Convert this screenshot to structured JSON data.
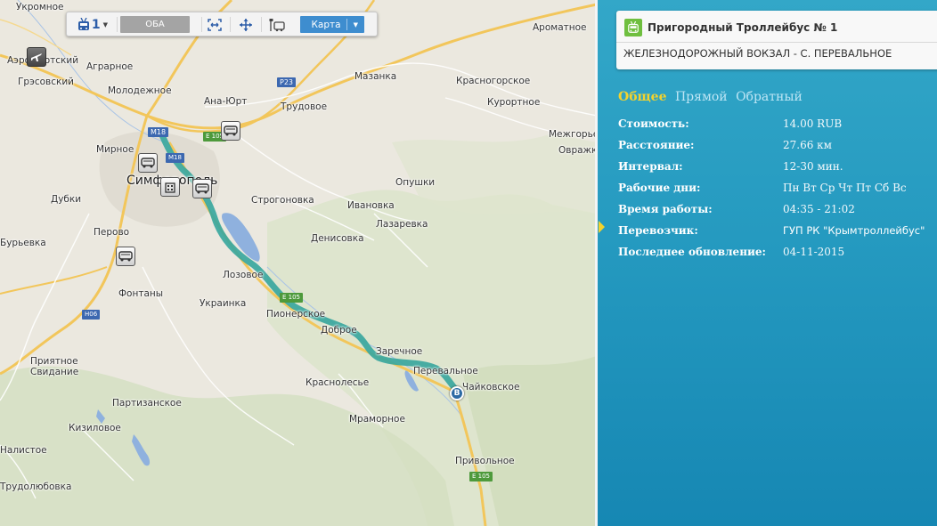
{
  "toolbar": {
    "route_icon": "trolleybus-icon",
    "route_number": "1",
    "oba_label": "ОБА",
    "fit_icon": "fit-bounds-icon",
    "pan_icon": "move-icon",
    "stops_icon": "bus-stop-icon",
    "map_type_label": "Карта"
  },
  "map": {
    "places": [
      {
        "name": "Укромное"
      },
      {
        "name": "Аэрофлотский"
      },
      {
        "name": "Аграрное"
      },
      {
        "name": "Грэсовский"
      },
      {
        "name": "Молодежное"
      },
      {
        "name": "Ана-Юрт"
      },
      {
        "name": "Мазанка"
      },
      {
        "name": "Красногорское"
      },
      {
        "name": "Ароматное"
      },
      {
        "name": "Трудовое"
      },
      {
        "name": "Курортное"
      },
      {
        "name": "Мирное"
      },
      {
        "name": "Симферополь"
      },
      {
        "name": "Межгорье"
      },
      {
        "name": "Овражки"
      },
      {
        "name": "Опушки"
      },
      {
        "name": "Строгоновка"
      },
      {
        "name": "Ивановка"
      },
      {
        "name": "Дубки"
      },
      {
        "name": "Лазаревка"
      },
      {
        "name": "Перово"
      },
      {
        "name": "Денисовка"
      },
      {
        "name": "Бурьевка"
      },
      {
        "name": "Лозовое"
      },
      {
        "name": "Фонтаны"
      },
      {
        "name": "Украинка"
      },
      {
        "name": "Пионерское"
      },
      {
        "name": "Доброе"
      },
      {
        "name": "Заречное"
      },
      {
        "name": "Приятное Свидание"
      },
      {
        "name": "Перевальное"
      },
      {
        "name": "Чайковское"
      },
      {
        "name": "Краснолесье"
      },
      {
        "name": "Партизанское"
      },
      {
        "name": "Мраморное"
      },
      {
        "name": "Кизиловое"
      },
      {
        "name": "Налистое"
      },
      {
        "name": "Привольное"
      },
      {
        "name": "Трудолюбовка"
      }
    ],
    "road_shields": [
      "M18",
      "P23",
      "E 105",
      "M18",
      "E 105",
      "H06",
      "E 105"
    ],
    "end_marker": "B",
    "route_color": "#3aa79e"
  },
  "panel": {
    "route_icon": "trolleybus-icon",
    "title": "Пригородный Троллейбус № 1",
    "route_name": "ЖЕЛЕЗНОДОРОЖНЫЙ ВОКЗАЛ - С. ПЕРЕВАЛЬНОЕ",
    "tabs": {
      "general": "Общее",
      "forward": "Прямой",
      "reverse": "Обратный"
    },
    "info": [
      {
        "label": "Стоимость:",
        "value": "14.00 RUB"
      },
      {
        "label": "Расстояние:",
        "value": "27.66 км"
      },
      {
        "label": "Интервал:",
        "value": "12-30 мин."
      },
      {
        "label": "Рабочие дни:",
        "value": "Пн Вт Ср Чт Пт Сб Вс"
      },
      {
        "label": "Время работы:",
        "value": "04:35 - 21:02"
      },
      {
        "label": "Перевозчик:",
        "value": "ГУП РК \"Крымтроллейбус\""
      },
      {
        "label": "Последнее обновление:",
        "value": "04-11-2015"
      }
    ],
    "colors": {
      "accent": "#f4d32d",
      "panel": "#259ac0",
      "route_badge": "#6fbf3f"
    }
  }
}
